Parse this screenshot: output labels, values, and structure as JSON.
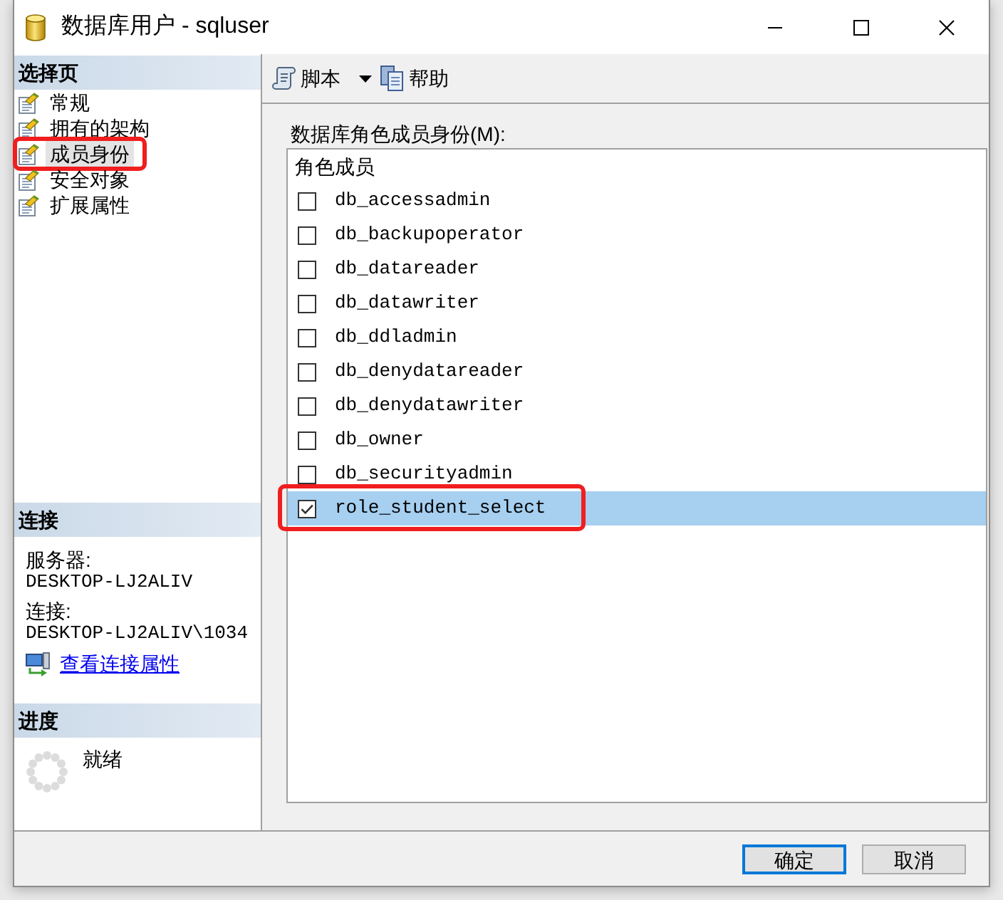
{
  "window": {
    "title": "数据库用户 - sqluser"
  },
  "sidebar": {
    "select_page": {
      "heading": "选择页",
      "items": [
        {
          "label": "常规",
          "selected": false,
          "highlighted": false
        },
        {
          "label": "拥有的架构",
          "selected": false,
          "highlighted": false
        },
        {
          "label": "成员身份",
          "selected": true,
          "highlighted": true
        },
        {
          "label": "安全对象",
          "selected": false,
          "highlighted": false
        },
        {
          "label": "扩展属性",
          "selected": false,
          "highlighted": false
        }
      ]
    },
    "connection": {
      "heading": "连接",
      "server_label": "服务器:",
      "server": "DESKTOP-LJ2ALIV",
      "connection_label": "连接:",
      "connection": "DESKTOP-LJ2ALIV\\1034",
      "link": "查看连接属性"
    },
    "progress": {
      "heading": "进度",
      "status": "就绪"
    }
  },
  "toolbar": {
    "items": [
      {
        "kind": "dropdown",
        "label": "脚本"
      },
      {
        "kind": "button",
        "label": "帮助"
      }
    ]
  },
  "role_membership": {
    "label": "数据库角色成员身份(M):",
    "column": "角色成员",
    "rows": [
      {
        "name": "db_accessadmin",
        "checked": false,
        "selected": false,
        "highlighted": false
      },
      {
        "name": "db_backupoperator",
        "checked": false,
        "selected": false,
        "highlighted": false
      },
      {
        "name": "db_datareader",
        "checked": false,
        "selected": false,
        "highlighted": false
      },
      {
        "name": "db_datawriter",
        "checked": false,
        "selected": false,
        "highlighted": false
      },
      {
        "name": "db_ddladmin",
        "checked": false,
        "selected": false,
        "highlighted": false
      },
      {
        "name": "db_denydatareader",
        "checked": false,
        "selected": false,
        "highlighted": false
      },
      {
        "name": "db_denydatawriter",
        "checked": false,
        "selected": false,
        "highlighted": false
      },
      {
        "name": "db_owner",
        "checked": false,
        "selected": false,
        "highlighted": false
      },
      {
        "name": "db_securityadmin",
        "checked": false,
        "selected": false,
        "highlighted": false
      },
      {
        "name": "role_student_select",
        "checked": true,
        "selected": true,
        "highlighted": true
      }
    ]
  },
  "buttons": [
    {
      "label": "确定",
      "default": true
    },
    {
      "label": "取消",
      "default": false
    }
  ]
}
